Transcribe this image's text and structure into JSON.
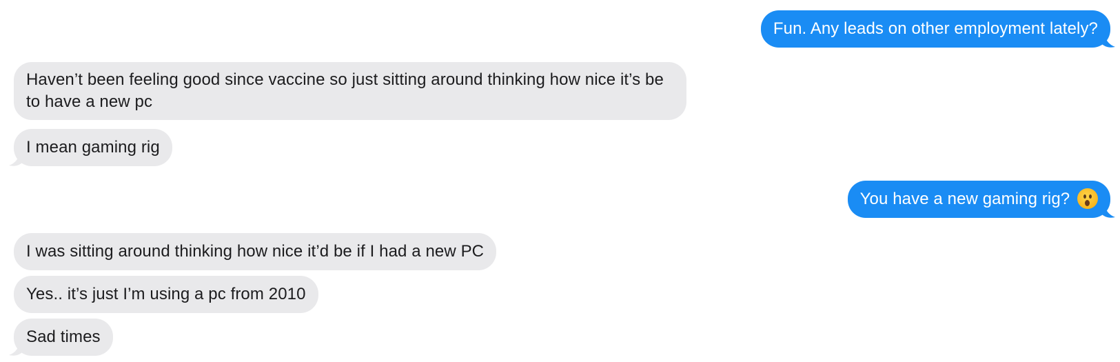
{
  "conversation": {
    "messages": [
      {
        "sender": "me",
        "text": "Fun. Any leads on other employment lately?"
      },
      {
        "sender": "them",
        "text": "Haven’t been feeling good since vaccine so just sitting around thinking how nice it’s be to have a new pc"
      },
      {
        "sender": "them",
        "text": "I mean gaming rig"
      },
      {
        "sender": "me",
        "text": "You have a new gaming rig?",
        "emoji": "hushed-face-emoji"
      },
      {
        "sender": "them",
        "text": "I was sitting around thinking how nice it’d be if I had a new PC"
      },
      {
        "sender": "them",
        "text": "Yes.. it’s just I’m using a pc from 2010"
      },
      {
        "sender": "them",
        "text": "Sad times"
      }
    ]
  },
  "colors": {
    "outgoing_bubble": "#1a8cf4",
    "incoming_bubble": "#e9e9eb",
    "outgoing_text": "#ffffff",
    "incoming_text": "#1c1c1e"
  }
}
